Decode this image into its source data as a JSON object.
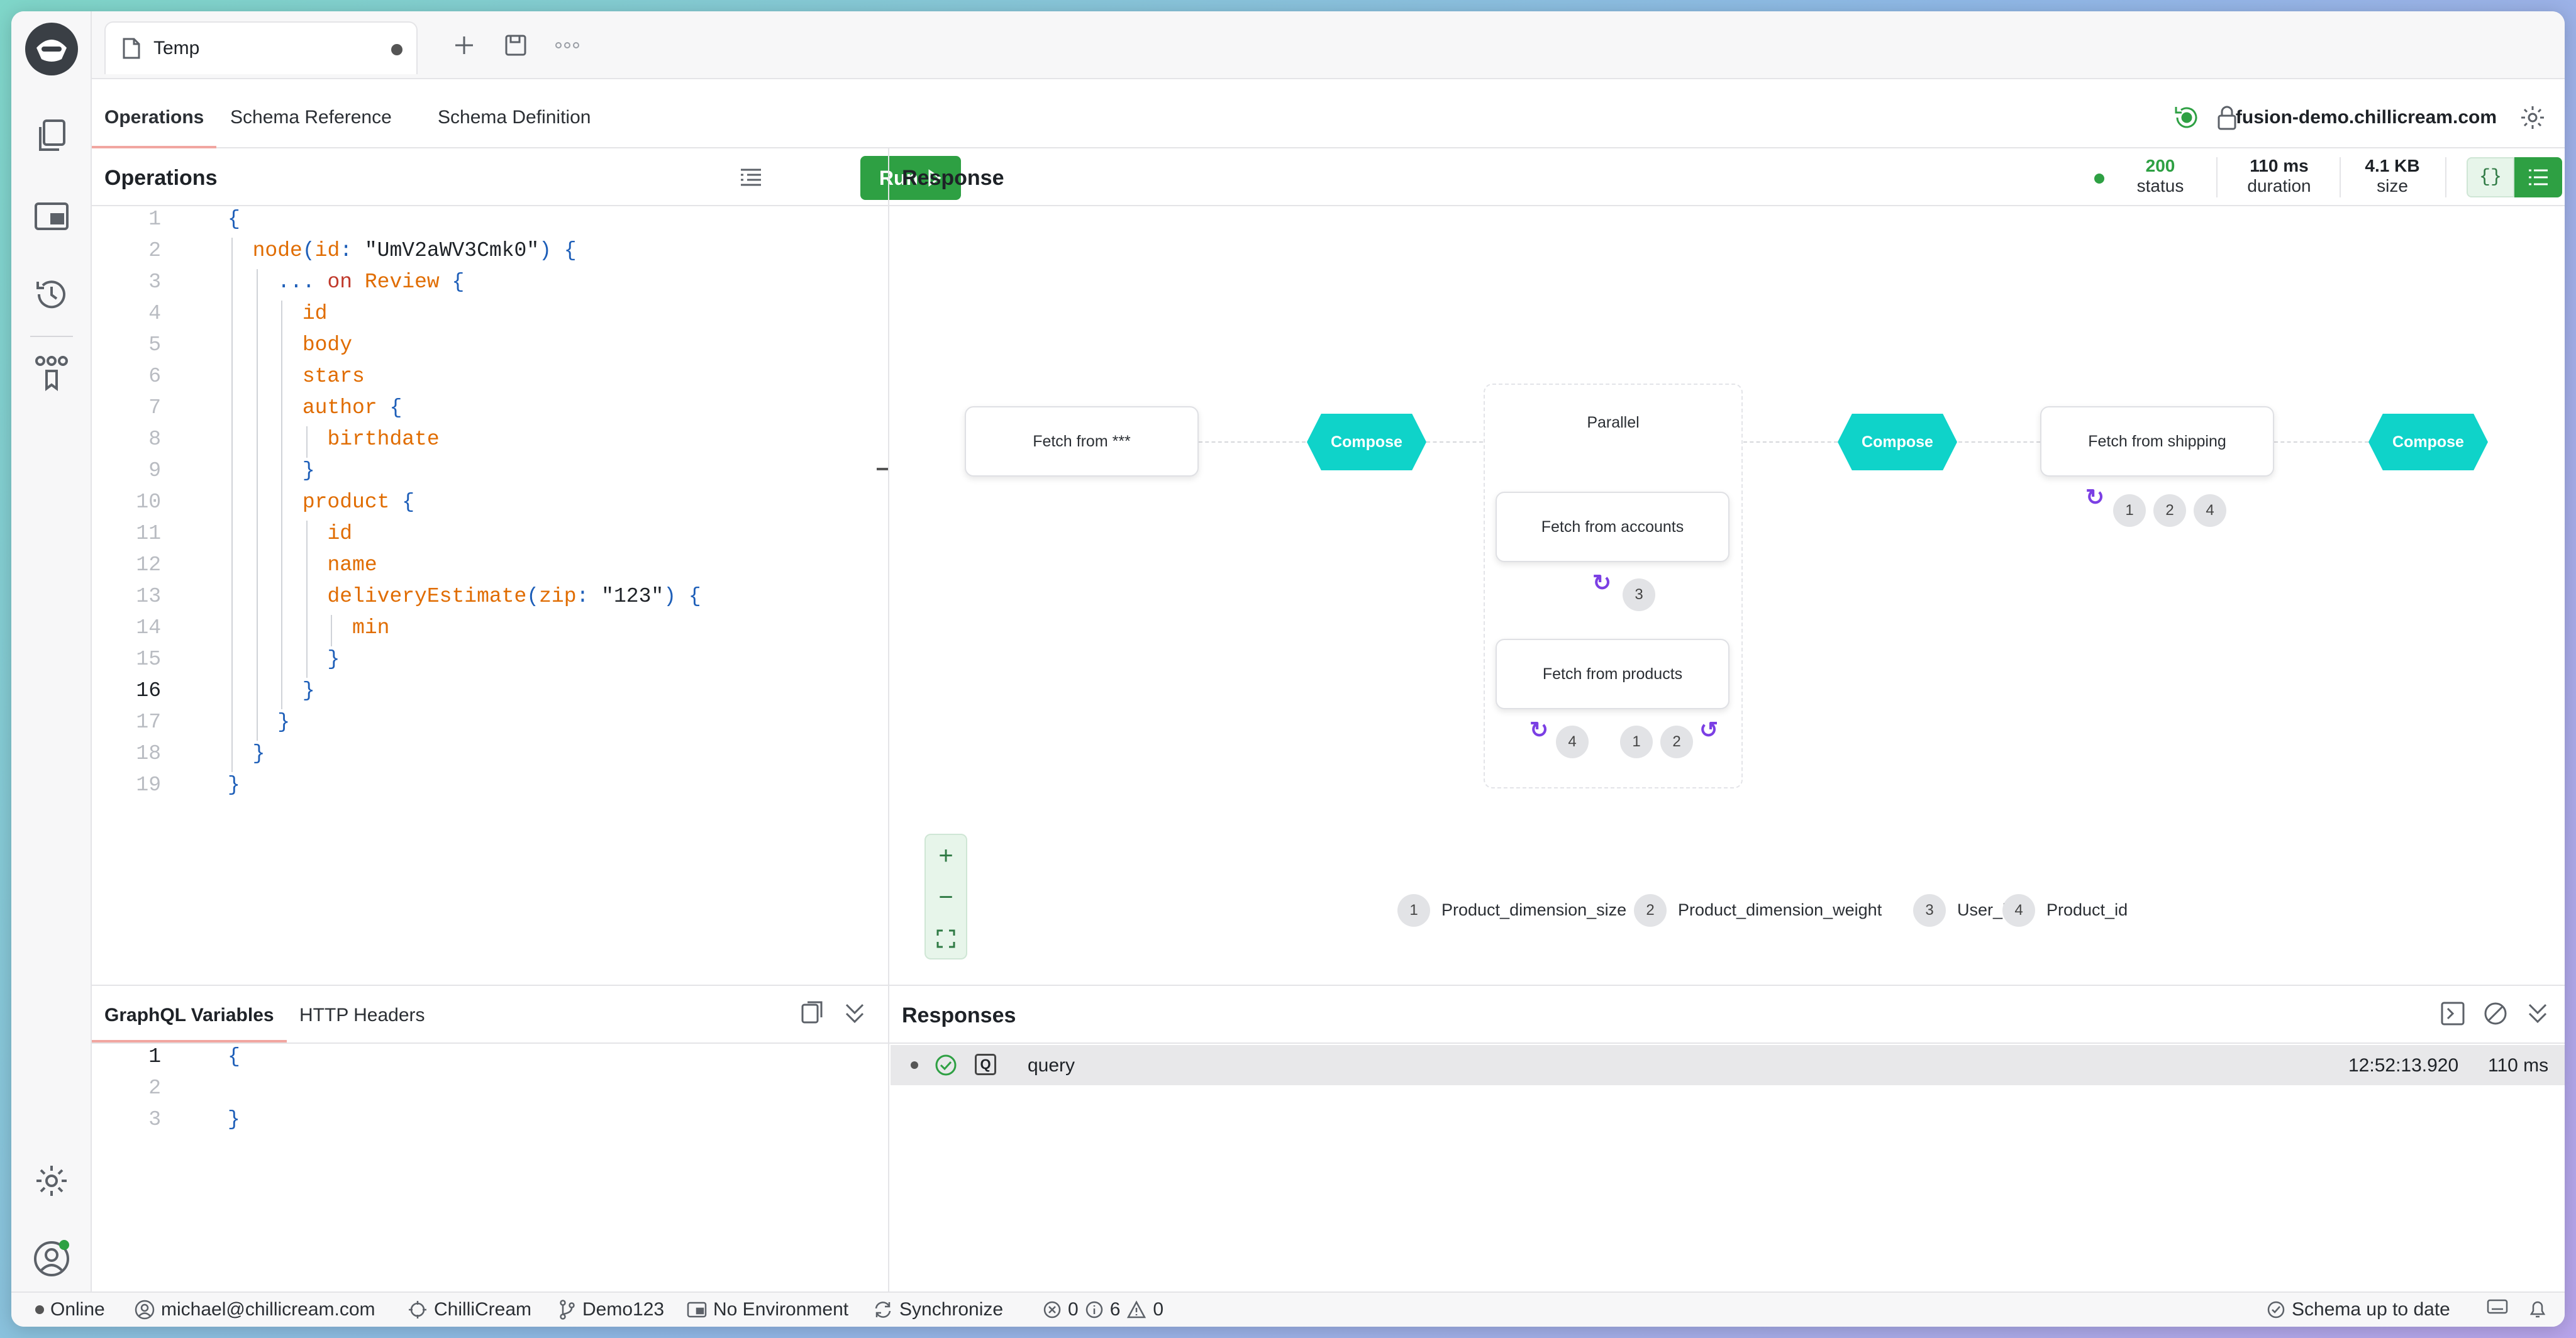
{
  "tab": {
    "title": "Temp"
  },
  "subtabs": [
    "Operations",
    "Schema Reference",
    "Schema Definition"
  ],
  "domain": "fusion-demo.chillicream.com",
  "operations": {
    "title": "Operations",
    "run_label": "Run",
    "lines": [
      "{",
      "  node(id: \"UmV2aWV3Cmk0\") {",
      "    ... on Review {",
      "      id",
      "      body",
      "      stars",
      "      author {",
      "        birthdate",
      "      }",
      "      product {",
      "        id",
      "        name",
      "        deliveryEstimate(zip: \"123\") {",
      "          min",
      "        }",
      "      }",
      "    }",
      "  }",
      "}"
    ],
    "current_line": 16
  },
  "response": {
    "title": "Response",
    "status_value": "200",
    "status_label": "status",
    "duration_value": "110 ms",
    "duration_label": "duration",
    "size_value": "4.1 KB",
    "size_label": "size"
  },
  "plan": {
    "fetch_star": "Fetch from ***",
    "compose": "Compose",
    "parallel": "Parallel",
    "fetch_accounts": "Fetch from accounts",
    "fetch_products": "Fetch from products",
    "fetch_shipping": "Fetch from shipping",
    "badges": {
      "one": "1",
      "two": "2",
      "three": "3",
      "four": "4"
    },
    "legend": [
      {
        "num": "1",
        "label": "Product_dimension_size"
      },
      {
        "num": "2",
        "label": "Product_dimension_weight"
      },
      {
        "num": "3",
        "label": "User_id"
      },
      {
        "num": "4",
        "label": "Product_id"
      }
    ]
  },
  "variables": {
    "tab_vars": "GraphQL Variables",
    "tab_headers": "HTTP Headers",
    "lines": [
      "{",
      "",
      "}"
    ]
  },
  "responses": {
    "title": "Responses",
    "rows": [
      {
        "name": "query",
        "time": "12:52:13.920",
        "duration": "110 ms"
      }
    ]
  },
  "statusbar": {
    "online": "Online",
    "user": "michael@chillicream.com",
    "org": "ChilliCream",
    "branch": "Demo123",
    "env": "No Environment",
    "sync": "Synchronize",
    "errors": "0",
    "infos": "6",
    "warnings": "0",
    "schema": "Schema up to date"
  },
  "colors": {
    "accent_green": "#2ea043",
    "compose": "#0fd3c9",
    "arrow": "#7b3fe4"
  }
}
